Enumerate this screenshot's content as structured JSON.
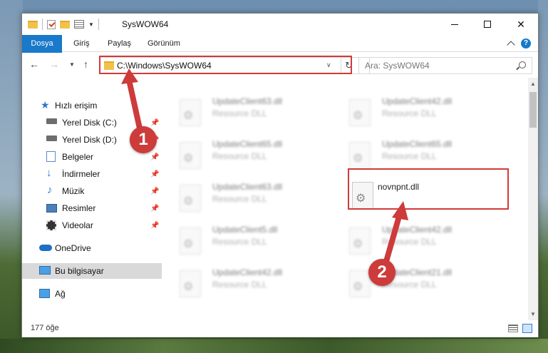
{
  "window": {
    "title": "SysWOW64",
    "controls": {
      "minimize": "—",
      "maximize": "☐",
      "close": "✕"
    }
  },
  "ribbon": {
    "tabs": [
      "Dosya",
      "Giriş",
      "Paylaş",
      "Görünüm"
    ],
    "help": "?"
  },
  "address": {
    "path": "C:\\Windows\\SysWOW64",
    "search_placeholder": "Ara: SysWOW64"
  },
  "nav": {
    "items": [
      {
        "label": "Hızlı erişim",
        "icon": "star-icon"
      },
      {
        "label": "Yerel Disk (C:)",
        "icon": "drive-icon",
        "pinned": true
      },
      {
        "label": "Yerel Disk (D:)",
        "icon": "drive-icon",
        "pinned": true
      },
      {
        "label": "Belgeler",
        "icon": "documents-icon",
        "pinned": true
      },
      {
        "label": "İndirmeler",
        "icon": "download-icon",
        "pinned": true
      },
      {
        "label": "Müzik",
        "icon": "music-icon",
        "pinned": true
      },
      {
        "label": "Resimler",
        "icon": "pictures-icon",
        "pinned": true
      },
      {
        "label": "Videolar",
        "icon": "video-icon",
        "pinned": true
      },
      {
        "label": "OneDrive",
        "icon": "cloud-icon"
      },
      {
        "label": "Bu bilgisayar",
        "icon": "computer-icon",
        "selected": true
      },
      {
        "label": "Ağ",
        "icon": "network-icon"
      }
    ]
  },
  "files": {
    "left": [
      {
        "name": "UpdateClient63.dll",
        "type": "Resource DLL"
      },
      {
        "name": "UpdateClient65.dll",
        "type": "Resource DLL"
      },
      {
        "name": "UpdateClient63.dll",
        "type": "Resource DLL"
      },
      {
        "name": "UpdateClient5.dll",
        "type": "Resource DLL"
      },
      {
        "name": "UpdateClient42.dll",
        "type": "Resource DLL"
      }
    ],
    "right": [
      {
        "name": "UpdateClient42.dll",
        "type": "Resource DLL"
      },
      {
        "name": "UpdateClient65.dll",
        "type": "Resource DLL"
      },
      {
        "name": "novnpnt.dll",
        "type": ""
      },
      {
        "name": "UpdateClient42.dll",
        "type": "Resource DLL"
      },
      {
        "name": "UpdateClient21.dll",
        "type": "Resource DLL"
      }
    ]
  },
  "status": {
    "count": "177 öğe"
  },
  "callouts": {
    "one": "1",
    "two": "2"
  },
  "colors": {
    "accent": "#1979ca",
    "highlight": "#d23a3a",
    "callout": "#cd3b3b"
  }
}
